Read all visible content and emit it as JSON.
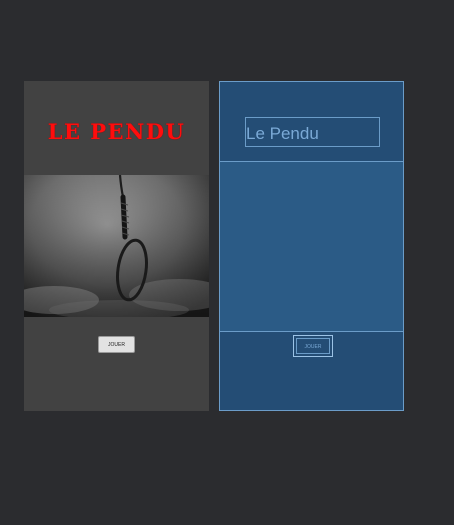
{
  "design": {
    "title": "LE PENDU",
    "image": "noose-photo",
    "button_label": "JOUER"
  },
  "blueprint": {
    "title": "Le Pendu",
    "button_label": "JOUER"
  },
  "colors": {
    "background": "#2b2c2f",
    "design_panel": "#424242",
    "title_red": "#ff0d0d",
    "blueprint_bg": "#244d75",
    "blueprint_line": "#6b9cc8"
  }
}
